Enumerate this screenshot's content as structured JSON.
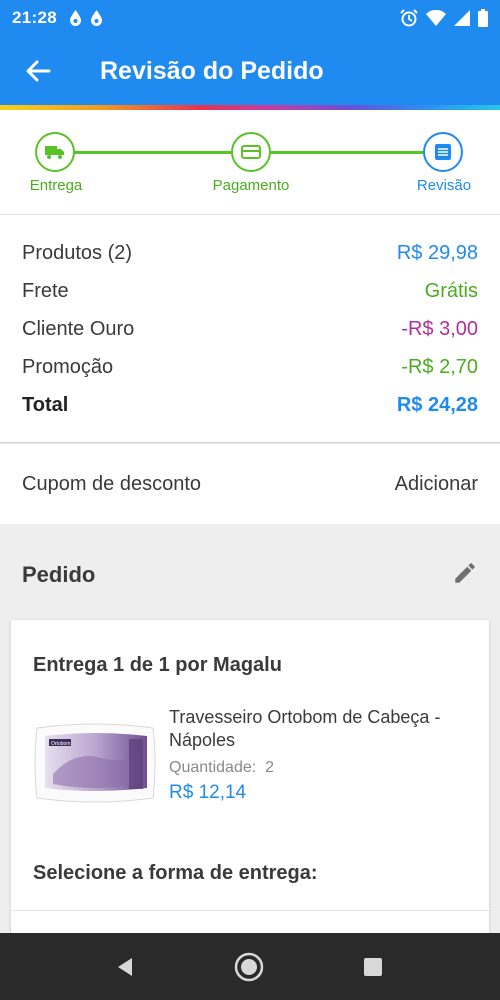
{
  "status_bar": {
    "time": "21:28"
  },
  "app_bar": {
    "title": "Revisão do Pedido"
  },
  "stepper": {
    "steps": [
      {
        "label": "Entrega",
        "icon": "truck-icon",
        "state": "done"
      },
      {
        "label": "Pagamento",
        "icon": "card-icon",
        "state": "done"
      },
      {
        "label": "Revisão",
        "icon": "list-icon",
        "state": "current"
      }
    ]
  },
  "summary": {
    "rows": [
      {
        "label": "Produtos (2)",
        "value": "R$ 29,98",
        "color": "#1f8af0"
      },
      {
        "label": "Frete",
        "value": "Grátis",
        "color": "#4aad1e"
      },
      {
        "label": "Cliente Ouro",
        "value": "-R$ 3,00",
        "color": "#b0309a"
      },
      {
        "label": "Promoção",
        "value": "-R$ 2,70",
        "color": "#4aad1e"
      }
    ],
    "total": {
      "label": "Total",
      "value": "R$ 24,28",
      "color": "#1f8af0"
    }
  },
  "coupon": {
    "label": "Cupom de desconto",
    "action": "Adicionar"
  },
  "order": {
    "heading": "Pedido",
    "delivery_title": "Entrega 1 de 1 por Magalu",
    "product": {
      "name": "Travesseiro Ortobom de Cabeça - Nápoles",
      "quantity_label": "Quantidade:",
      "quantity": "2",
      "price": "R$ 12,14",
      "thumb_brand": "Ortobom"
    },
    "select_shipping": "Selecione a forma de entrega:"
  },
  "colors": {
    "primary": "#1f8af0",
    "success": "#4aad1e",
    "gold": "#b0309a"
  }
}
